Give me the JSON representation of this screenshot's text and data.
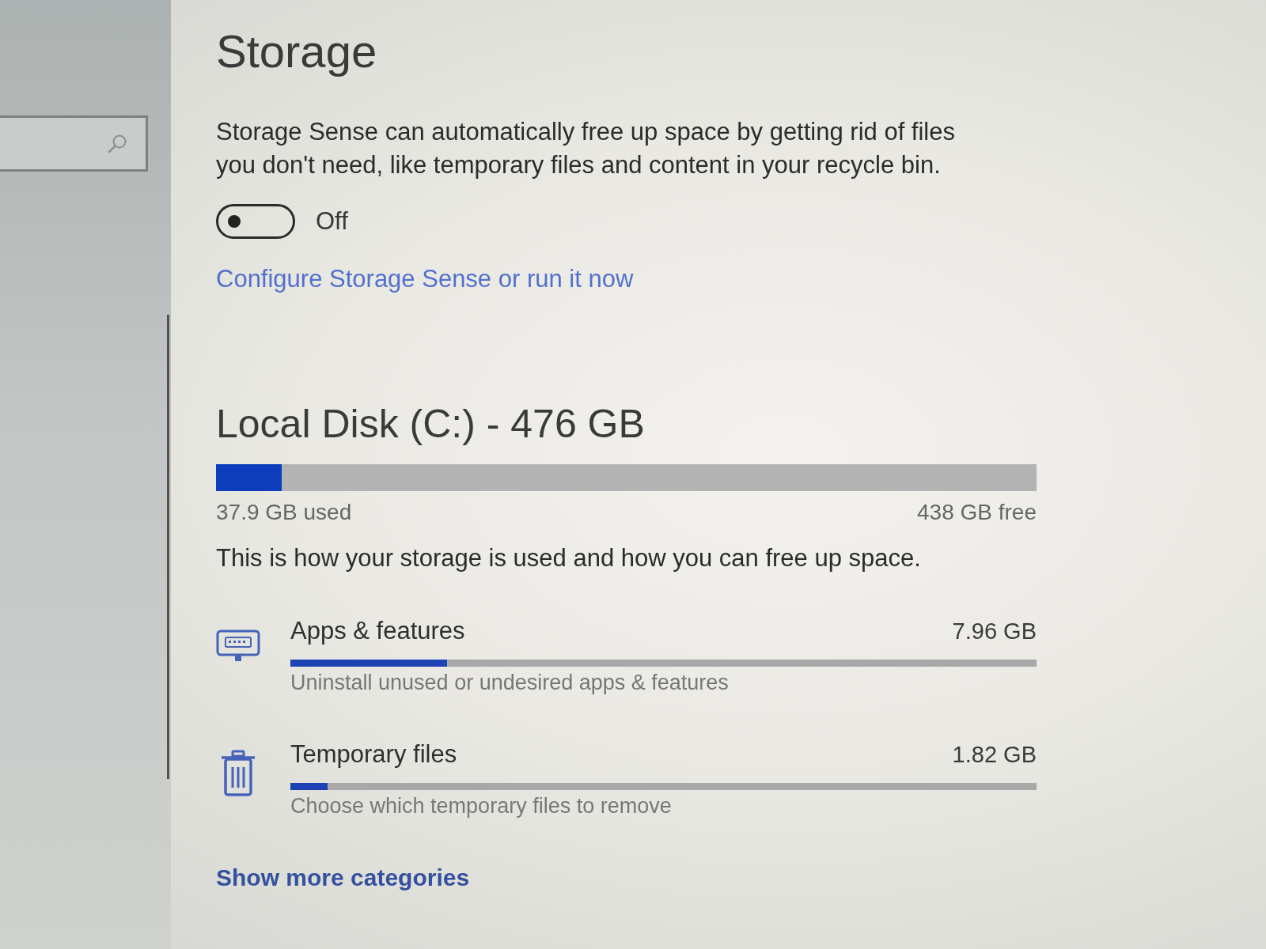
{
  "page": {
    "title": "Storage"
  },
  "storage_sense": {
    "description": "Storage Sense can automatically free up space by getting rid of files you don't need, like temporary files and content in your recycle bin.",
    "toggle": {
      "on": false,
      "label": "Off"
    },
    "link": "Configure Storage Sense or run it now"
  },
  "disk": {
    "title": "Local Disk (C:) - 476 GB",
    "usage": {
      "level": 0.08
    },
    "used": "37.9 GB used",
    "free": "438 GB free",
    "description": "This is how your storage is used and how you can free up space."
  },
  "categories": [
    {
      "kind": "apps",
      "title": "Apps & features",
      "size": "7.96 GB",
      "level": 0.21,
      "subtitle": "Uninstall unused or undesired apps & features"
    },
    {
      "kind": "temp",
      "title": "Temporary files",
      "size": "1.82 GB",
      "level": 0.05,
      "subtitle": "Choose which temporary files to remove"
    }
  ],
  "show_more": "Show more categories"
}
